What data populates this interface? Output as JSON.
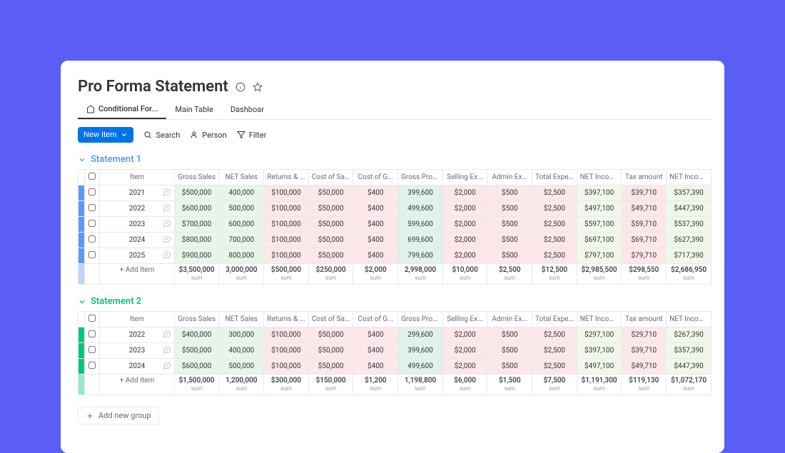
{
  "header": {
    "title": "Pro Forma Statement"
  },
  "tabs": [
    {
      "label": "Conditional For...",
      "active": true,
      "icon": true
    },
    {
      "label": "Main Table",
      "active": false
    },
    {
      "label": "Dashboar",
      "active": false
    }
  ],
  "toolbar": {
    "newItem": "New Item",
    "search": "Search",
    "person": "Person",
    "filter": "Filter"
  },
  "columns": [
    "Item",
    "Gross Sales",
    "NET Sales",
    "Returns & ...",
    "Cost of Sal...",
    "Cost of G...",
    "Gross Profit ...",
    "Selling Ex...",
    "Admin Ex...",
    "Total Expe...",
    "NET Incom...",
    "Tax amount",
    "NET Income (po..."
  ],
  "groups": [
    {
      "name": "Statement 1",
      "color": "#579bfc",
      "barClass": "bar-blue",
      "rows": [
        {
          "item": "2021",
          "gs": "$500,000",
          "ns": "400,000",
          "ret": "$100,000",
          "cs": "$50,000",
          "cg": "$400",
          "gp": "399,600",
          "se": "$2,000",
          "ae": "$500",
          "te": "$2,500",
          "ni": "$397,100",
          "tx": "$39,710",
          "nip": "$357,390"
        },
        {
          "item": "2022",
          "gs": "$600,000",
          "ns": "500,000",
          "ret": "$100,000",
          "cs": "$50,000",
          "cg": "$400",
          "gp": "499,600",
          "se": "$2,000",
          "ae": "$500",
          "te": "$2,500",
          "ni": "$497,100",
          "tx": "$49,710",
          "nip": "$447,390"
        },
        {
          "item": "2023",
          "gs": "$700,000",
          "ns": "600,000",
          "ret": "$100,000",
          "cs": "$50,000",
          "cg": "$400",
          "gp": "599,600",
          "se": "$2,000",
          "ae": "$500",
          "te": "$2,500",
          "ni": "$597,100",
          "tx": "$59,710",
          "nip": "$537,390"
        },
        {
          "item": "2024",
          "gs": "$800,000",
          "ns": "700,000",
          "ret": "$100,000",
          "cs": "$50,000",
          "cg": "$400",
          "gp": "699,600",
          "se": "$2,000",
          "ae": "$500",
          "te": "$2,500",
          "ni": "$697,100",
          "tx": "$69,710",
          "nip": "$627,390"
        },
        {
          "item": "2025",
          "gs": "$900,000",
          "ns": "800,000",
          "ret": "$100,000",
          "cs": "$50,000",
          "cg": "$400",
          "gp": "799,600",
          "se": "$2,000",
          "ae": "$500",
          "te": "$2,500",
          "ni": "$797,100",
          "tx": "$79,710",
          "nip": "$717,390"
        }
      ],
      "sum": {
        "gs": "$3,500,000",
        "ns": "3,000,000",
        "ret": "$500,000",
        "cs": "$250,000",
        "cg": "$2,000",
        "gp": "2,998,000",
        "se": "$10,000",
        "ae": "$2,500",
        "te": "$12,500",
        "ni": "$2,985,500",
        "tx": "$298,550",
        "nip": "$2,686,950"
      }
    },
    {
      "name": "Statement 2",
      "color": "#00c875",
      "barClass": "bar-green",
      "rows": [
        {
          "item": "2022",
          "gs": "$400,000",
          "ns": "300,000",
          "ret": "$100,000",
          "cs": "$50,000",
          "cg": "$400",
          "gp": "299,600",
          "se": "$2,000",
          "ae": "$500",
          "te": "$2,500",
          "ni": "$297,100",
          "tx": "$29,710",
          "nip": "$267,390"
        },
        {
          "item": "2023",
          "gs": "$500,000",
          "ns": "400,000",
          "ret": "$100,000",
          "cs": "$50,000",
          "cg": "$400",
          "gp": "399,600",
          "se": "$2,000",
          "ae": "$500",
          "te": "$2,500",
          "ni": "$397,100",
          "tx": "$39,710",
          "nip": "$357,390"
        },
        {
          "item": "2024",
          "gs": "$600,000",
          "ns": "500,000",
          "ret": "$100,000",
          "cs": "$50,000",
          "cg": "$400",
          "gp": "499,600",
          "se": "$2,000",
          "ae": "$500",
          "te": "$2,500",
          "ni": "$497,100",
          "tx": "$49,710",
          "nip": "$447,390"
        }
      ],
      "sum": {
        "gs": "$1,500,000",
        "ns": "1,200,000",
        "ret": "$300,000",
        "cs": "$150,000",
        "cg": "$1,200",
        "gp": "1,198,800",
        "se": "$6,000",
        "ae": "$1,500",
        "te": "$7,500",
        "ni": "$1,191,300",
        "tx": "$119,130",
        "nip": "$1,072,170"
      }
    }
  ],
  "addItem": "+ Add Item",
  "addGroup": "Add new group",
  "sumLabel": "sum"
}
